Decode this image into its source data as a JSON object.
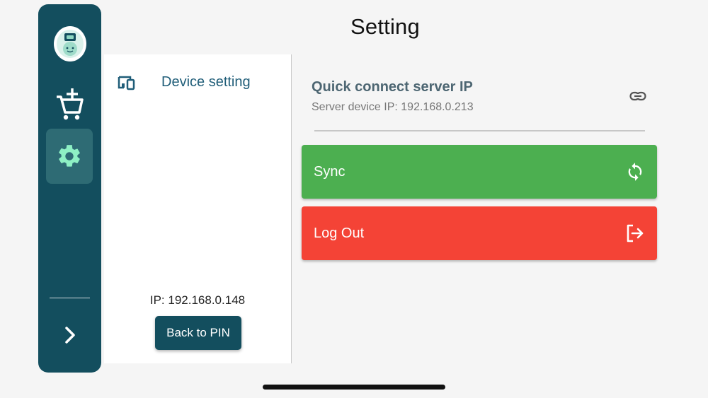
{
  "header": {
    "title": "Setting"
  },
  "sidebar": {
    "items": [
      {
        "name": "add-to-cart",
        "icon": "cart-plus-icon"
      },
      {
        "name": "settings",
        "icon": "gear-icon",
        "active": true
      }
    ],
    "expand_icon": "chevron-right-icon"
  },
  "settings_nav": {
    "items": [
      {
        "label": "Device setting",
        "icon": "devices-icon"
      }
    ],
    "device_ip": "IP: 192.168.0.148",
    "back_button": "Back to PIN"
  },
  "quick_connect": {
    "title": "Quick connect server IP",
    "server_ip": "Server device IP: 192.168.0.213",
    "icon": "link-icon"
  },
  "actions": {
    "sync": {
      "label": "Sync",
      "icon": "sync-icon",
      "color": "#4caf50"
    },
    "logout": {
      "label": "Log Out",
      "icon": "logout-icon",
      "color": "#f44336"
    }
  },
  "colors": {
    "rail": "#134e5e",
    "accent": "#1f5d78",
    "active_icon": "#8ef0c4"
  }
}
